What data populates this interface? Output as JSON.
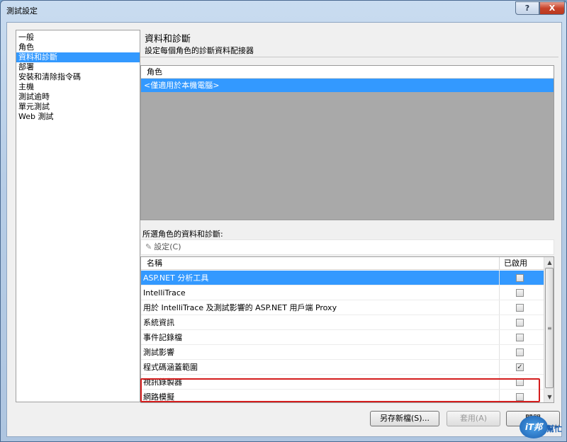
{
  "window": {
    "title": "測試設定",
    "help_label": "?",
    "close_label": "X"
  },
  "nav": {
    "items": [
      {
        "label": "一般",
        "selected": false
      },
      {
        "label": "角色",
        "selected": false
      },
      {
        "label": "資料和診斷",
        "selected": true
      },
      {
        "label": "部署",
        "selected": false
      },
      {
        "label": "安裝和清除指令碼",
        "selected": false
      },
      {
        "label": "主機",
        "selected": false
      },
      {
        "label": "測試逾時",
        "selected": false
      },
      {
        "label": "單元測試",
        "selected": false
      },
      {
        "label": "Web 測試",
        "selected": false
      }
    ]
  },
  "main": {
    "heading": "資料和診斷",
    "subheading": "設定每個角色的診斷資料配接器",
    "roles": {
      "header": "角色",
      "rows": [
        "<僅適用於本機電腦>"
      ]
    },
    "diagnostics_label": "所選角色的資料和診斷:",
    "toolbar": {
      "settings_label": "設定(C)"
    },
    "grid": {
      "col_name": "名稱",
      "col_enabled": "已啟用",
      "rows": [
        {
          "name": "ASP.NET 分析工具",
          "checked": false,
          "selected": true
        },
        {
          "name": "IntelliTrace",
          "checked": false,
          "selected": false
        },
        {
          "name": "用於 IntelliTrace 及測試影響的 ASP.NET 用戶端 Proxy",
          "checked": false,
          "selected": false
        },
        {
          "name": "系統資訊",
          "checked": false,
          "selected": false
        },
        {
          "name": "事件記錄檔",
          "checked": false,
          "selected": false
        },
        {
          "name": "測試影響",
          "checked": false,
          "selected": false
        },
        {
          "name": "程式碼涵蓋範圍",
          "checked": true,
          "selected": false
        },
        {
          "name": "視訊錄製器",
          "checked": false,
          "selected": false
        },
        {
          "name": "網路模擬",
          "checked": false,
          "selected": false
        }
      ]
    }
  },
  "buttons": {
    "save_as": "另存新檔(S)...",
    "apply": "套用(A)",
    "close": "關閉"
  },
  "logo": {
    "mark": "iT邦",
    "text": "幫忙"
  },
  "colors": {
    "selection": "#3399ff",
    "highlight_box": "#d41e1e"
  }
}
